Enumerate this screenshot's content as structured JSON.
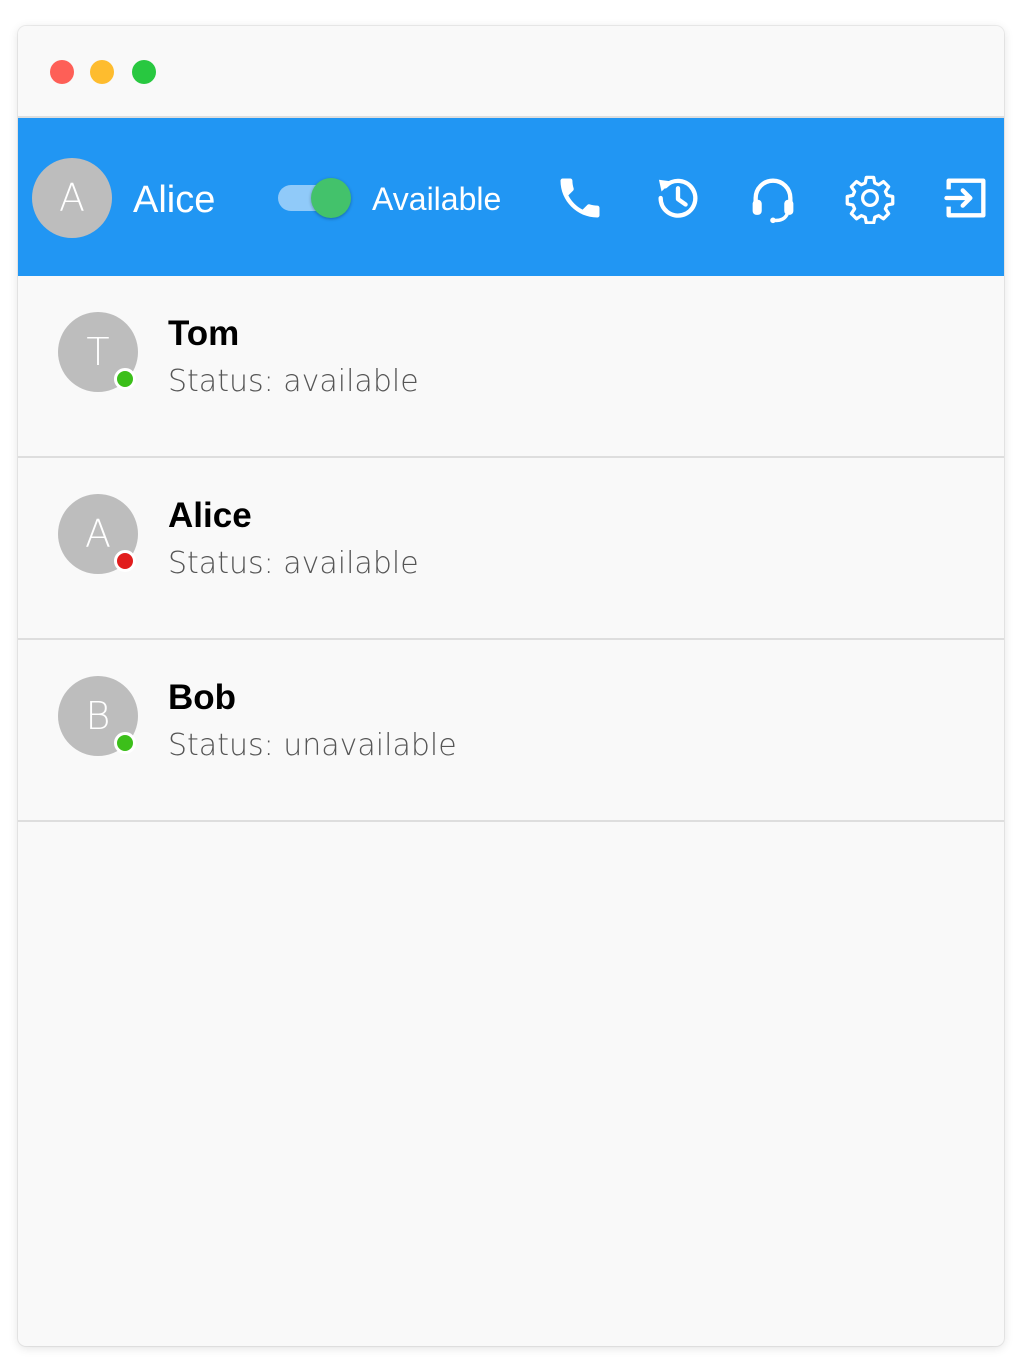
{
  "window": {
    "controls": {
      "close_color": "#fe5f57",
      "minimize_color": "#febc2e",
      "zoom_color": "#28c840"
    }
  },
  "header": {
    "background": "#2196f3",
    "user": {
      "initial": "A",
      "name": "Alice"
    },
    "availability": {
      "on": true,
      "label": "Available"
    },
    "actions": [
      {
        "icon": "phone-icon"
      },
      {
        "icon": "history-icon"
      },
      {
        "icon": "headset-icon"
      },
      {
        "icon": "settings-gear-icon"
      },
      {
        "icon": "logout-icon"
      }
    ]
  },
  "contacts": [
    {
      "initial": "T",
      "name": "Tom",
      "status": "Status: available",
      "presence_color": "#3cbf1a"
    },
    {
      "initial": "A",
      "name": "Alice",
      "status": "Status: available",
      "presence_color": "#e11d1d"
    },
    {
      "initial": "B",
      "name": "Bob",
      "status": "Status: unavailable",
      "presence_color": "#3cbf1a"
    }
  ]
}
